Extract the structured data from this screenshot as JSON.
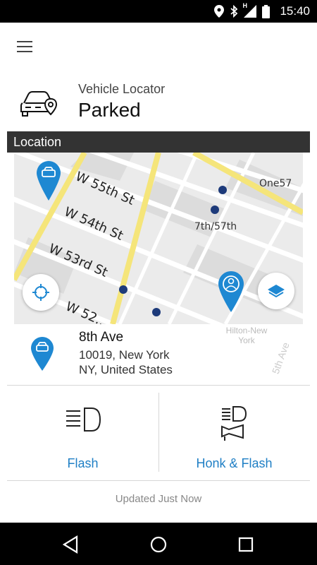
{
  "status_bar": {
    "time": "15:40",
    "icons": [
      "location-icon",
      "bluetooth-icon",
      "signal-icon",
      "battery-icon"
    ],
    "signal_label": "H"
  },
  "app_bar": {
    "menu_icon": "hamburger-menu-icon"
  },
  "header": {
    "icon": "car-location-icon",
    "subtitle": "Vehicle Locator",
    "title": "Parked"
  },
  "section": {
    "title": "Location"
  },
  "map": {
    "streets": [
      "W 55th St",
      "W 54th St",
      "W 53rd St",
      "W 52..."
    ],
    "labels": [
      "One57",
      "7th/57th",
      "Hilton-New York",
      "5th Ave"
    ],
    "pins": [
      "car-pin-icon",
      "user-pin-icon"
    ],
    "buttons": [
      "locate-icon",
      "layers-icon"
    ]
  },
  "address": {
    "line1": "8th Ave",
    "line2": "10019, New York",
    "line3": "NY, United States"
  },
  "actions": [
    {
      "label": "Flash",
      "icon": "headlight-icon"
    },
    {
      "label": "Honk & Flash",
      "icon": "horn-headlight-icon"
    }
  ],
  "updated": "Updated Just Now",
  "colors": {
    "accent": "#1f7fc5",
    "pin": "#1e88d2",
    "section_bar": "#333333"
  },
  "nav": [
    "back-icon",
    "home-icon",
    "recents-icon"
  ]
}
